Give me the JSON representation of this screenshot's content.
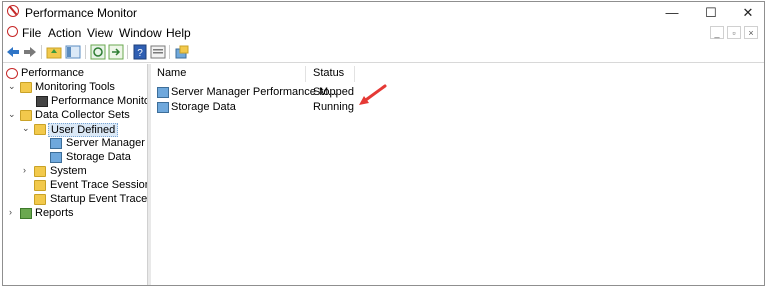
{
  "window": {
    "title": "Performance Monitor"
  },
  "titlebar": {
    "minimize_glyph": "—",
    "maximize_glyph": "☐",
    "close_glyph": "✕"
  },
  "menu": {
    "items": [
      "File",
      "Action",
      "View",
      "Window",
      "Help"
    ],
    "mdi_buttons": [
      "_",
      "▫",
      "×"
    ]
  },
  "toolbar": {
    "icons": [
      "back-icon",
      "forward-icon",
      "up-folder-icon",
      "show-hide-tree-icon",
      "refresh-icon",
      "export-icon",
      "help-icon",
      "properties-icon",
      "new-icon"
    ]
  },
  "tree": {
    "items": [
      {
        "label": "Performance",
        "icon": "performance-icon"
      },
      {
        "label": "Monitoring Tools",
        "icon": "folder-icon"
      },
      {
        "label": "Performance Monitor",
        "icon": "monitor-icon"
      },
      {
        "label": "Data Collector Sets",
        "icon": "folder-icon"
      },
      {
        "label": "User Defined",
        "icon": "folder-icon"
      },
      {
        "label": "Server Manager Per",
        "icon": "data-collector-icon"
      },
      {
        "label": "Storage Data",
        "icon": "data-collector-icon"
      },
      {
        "label": "System",
        "icon": "folder-icon"
      },
      {
        "label": "Event Trace Sessions",
        "icon": "folder-icon"
      },
      {
        "label": "Startup Event Trace Ses",
        "icon": "folder-icon"
      },
      {
        "label": "Reports",
        "icon": "reports-icon"
      }
    ]
  },
  "list": {
    "columns": {
      "name": "Name",
      "status": "Status"
    },
    "rows": [
      {
        "name": "Server Manager Performance M...",
        "status": "Stopped"
      },
      {
        "name": "Storage Data",
        "status": "Running"
      }
    ]
  },
  "colors": {
    "annotation_arrow": "#e53935",
    "selection": "#dbe9f7"
  }
}
